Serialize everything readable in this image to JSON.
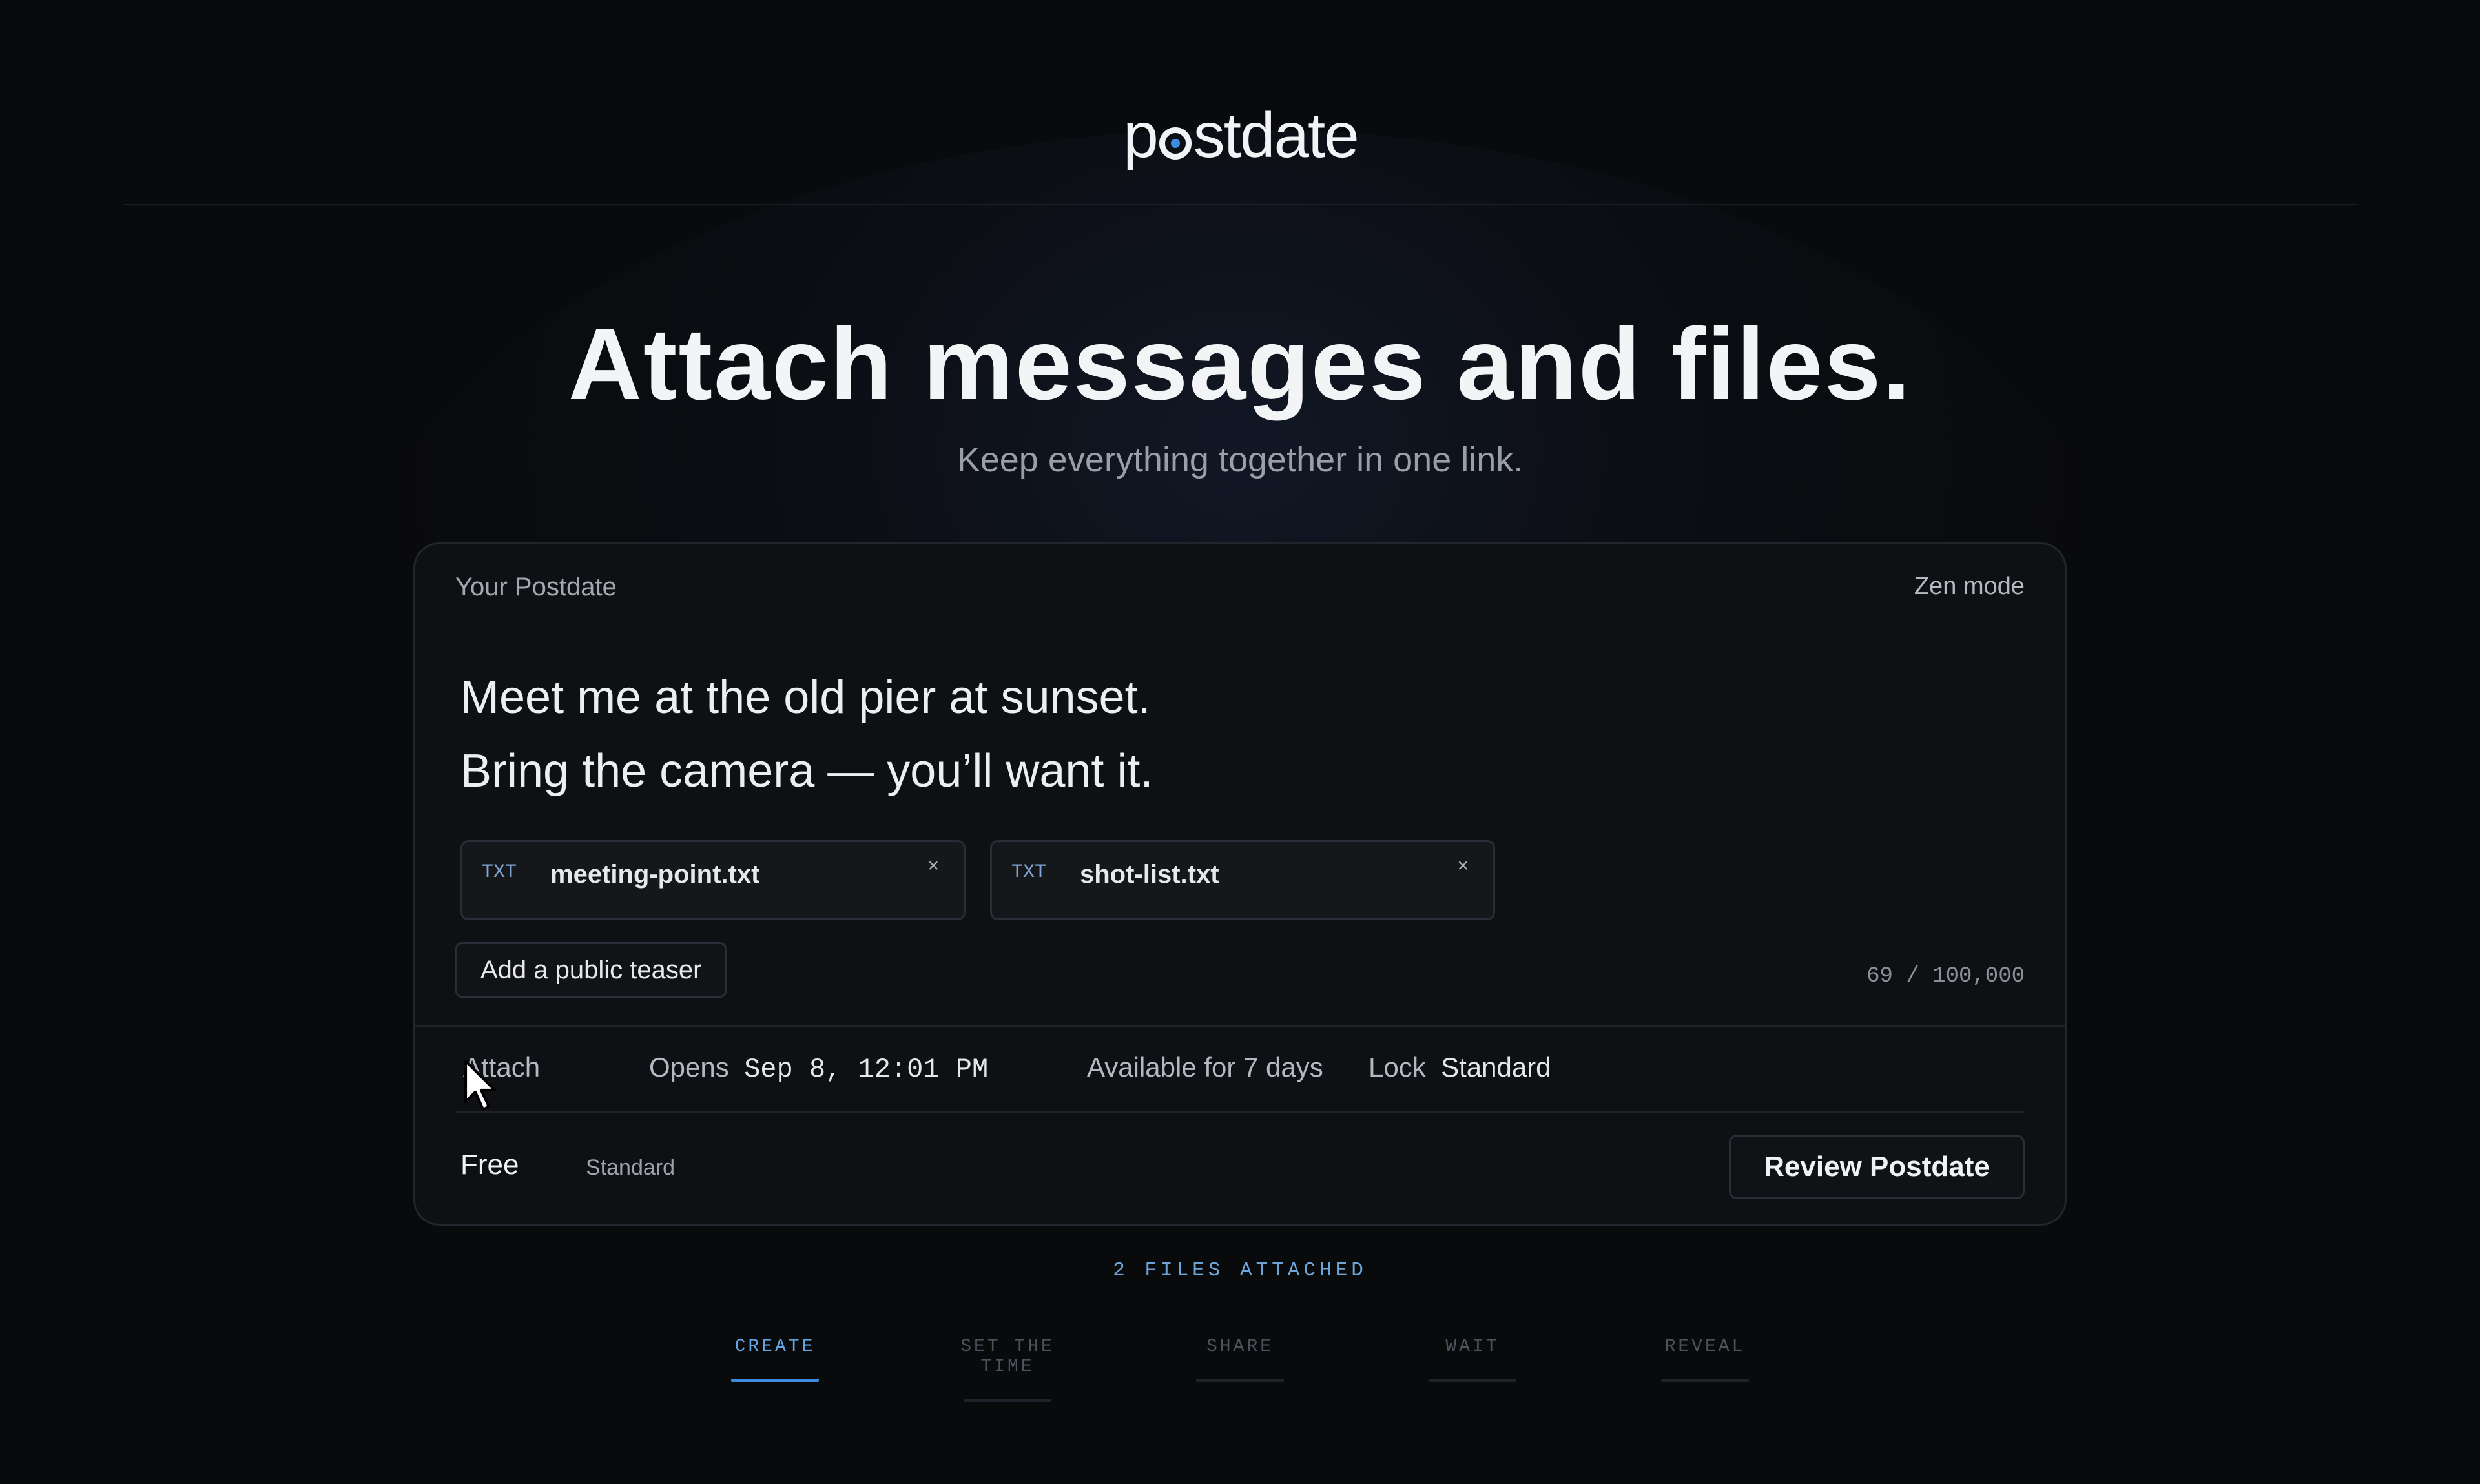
{
  "brand": {
    "logo_prefix": "p",
    "logo_suffix": "stdate"
  },
  "hero": {
    "title": "Attach messages and files.",
    "subtitle": "Keep everything together in one link."
  },
  "card": {
    "label": "Your Postdate",
    "zen_mode": "Zen mode",
    "message_lines": [
      "Meet me at the old pier at sunset.",
      "Bring the camera — you’ll want it."
    ],
    "files": [
      {
        "type": "TXT",
        "name": "meeting-point.txt",
        "remove": "×"
      },
      {
        "type": "TXT",
        "name": "shot-list.txt",
        "remove": "×"
      }
    ],
    "teaser_button": "Add a public teaser",
    "char_count": "69 / 100,000",
    "toolbar": {
      "attach": "Attach",
      "opens_label": "Opens",
      "opens_value": "Sep 8, 12:01 PM",
      "availability": "Available for 7 days",
      "lock_label": "Lock",
      "lock_value": "Standard"
    },
    "plan": {
      "name": "Free",
      "tier": "Standard"
    },
    "review_button": "Review Postdate"
  },
  "status": {
    "files_attached": "2 FILES ATTACHED"
  },
  "steps": [
    {
      "label": "CREATE",
      "active": true
    },
    {
      "label": "SET THE TIME",
      "active": false
    },
    {
      "label": "SHARE",
      "active": false
    },
    {
      "label": "WAIT",
      "active": false
    },
    {
      "label": "REVEAL",
      "active": false
    }
  ],
  "colors": {
    "accent": "#3c8ddf",
    "background": "#090a0c",
    "card": "#0f1013"
  }
}
